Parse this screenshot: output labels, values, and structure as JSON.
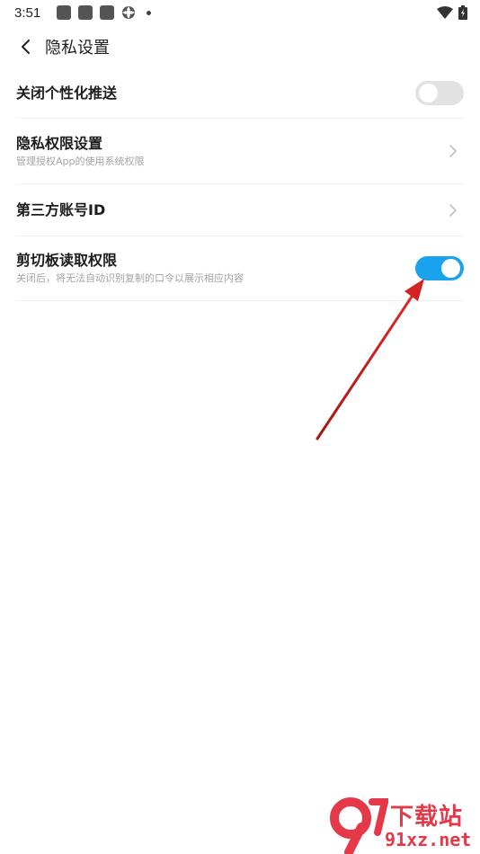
{
  "status_bar": {
    "time": "3:51",
    "icons": [
      "notification-square-icon",
      "notification-square-icon",
      "notification-square-icon",
      "sync-icon",
      "dot-icon",
      "wifi-icon",
      "battery-charging-icon"
    ]
  },
  "header": {
    "back_icon": "chevron-left-icon",
    "title": "隐私设置"
  },
  "settings": [
    {
      "title": "关闭个性化推送",
      "subtitle": "",
      "control": "toggle",
      "enabled": false
    },
    {
      "title": "隐私权限设置",
      "subtitle": "管理授权App的使用系统权限",
      "control": "chevron"
    },
    {
      "title": "第三方账号ID",
      "subtitle": "",
      "control": "chevron"
    },
    {
      "title": "剪切板读取权限",
      "subtitle": "关闭后，将无法自动识别复制的口令以展示相应内容",
      "control": "toggle",
      "enabled": true
    }
  ],
  "colors": {
    "toggle_on": "#1aa3ec",
    "toggle_off": "#e2e2e2",
    "annotation_arrow": "#d32222",
    "watermark": "#e5394a"
  },
  "watermark": {
    "top_text": "下载站",
    "bottom_text": "91xz.net"
  }
}
